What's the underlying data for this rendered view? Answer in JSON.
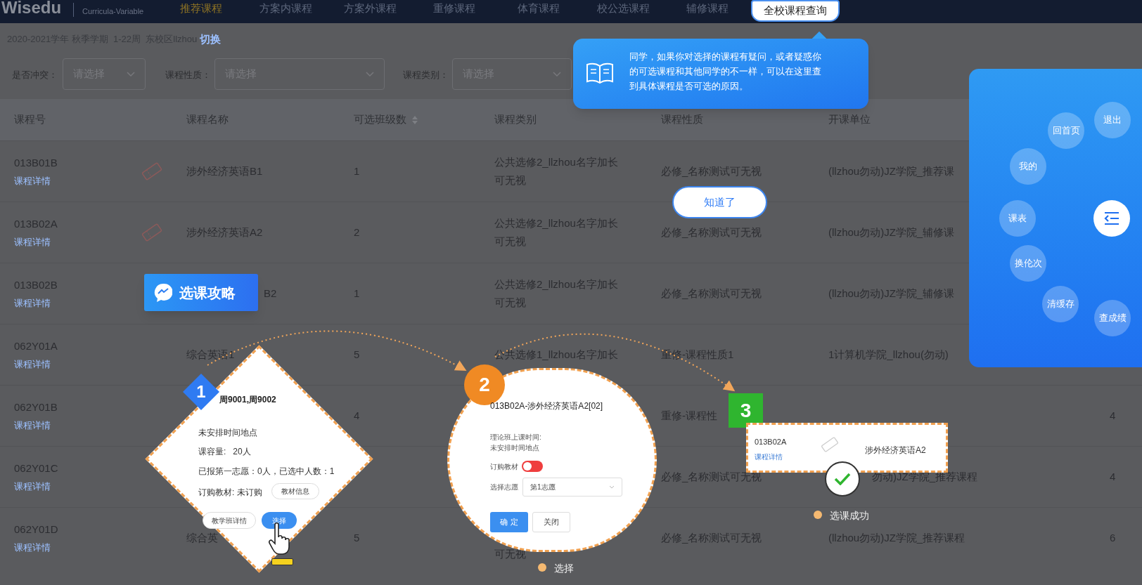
{
  "nav": {
    "logo": "Wisedu",
    "subtitle": "Curricula-Variable",
    "tabs": [
      {
        "label": "推荐课程",
        "selected": true,
        "spotlight": false
      },
      {
        "label": "方案内课程",
        "selected": false,
        "spotlight": false
      },
      {
        "label": "方案外课程",
        "selected": false,
        "spotlight": false
      },
      {
        "label": "重修课程",
        "selected": false,
        "spotlight": false
      },
      {
        "label": "体育课程",
        "selected": false,
        "spotlight": false
      },
      {
        "label": "校公选课程",
        "selected": false,
        "spotlight": false
      },
      {
        "label": "辅修课程",
        "selected": false,
        "spotlight": false
      },
      {
        "label": "全校课程查询",
        "selected": false,
        "spotlight": true
      }
    ]
  },
  "term": {
    "text": "2020-2021学年 秋季学期  1-22周  东校区llzhou",
    "switch_link": "切换"
  },
  "filters": [
    {
      "label": "是否冲突：",
      "placeholder": "请选择"
    },
    {
      "label": "课程性质：",
      "placeholder": "请选择"
    },
    {
      "label": "课程类别：",
      "placeholder": "请选择"
    }
  ],
  "table": {
    "columns": [
      {
        "label": "课程号",
        "sortable": false
      },
      {
        "label": "课程名称",
        "sortable": false
      },
      {
        "label": "可选班级数",
        "sortable": true
      },
      {
        "label": "课程类别",
        "sortable": false
      },
      {
        "label": "课程性质",
        "sortable": false
      },
      {
        "label": "开课单位",
        "sortable": false
      }
    ],
    "rows": [
      {
        "code": "013B01B",
        "detail_link": "课程详情",
        "stamp": true,
        "name": "涉外经济英语B1",
        "count": "1",
        "category": "公共选修2_llzhou名字加长可无视",
        "nature": "必修_名称测试可无视",
        "department": "(llzhou勿动)JZ学院_推荐课"
      },
      {
        "code": "013B02A",
        "detail_link": "课程详情",
        "stamp": true,
        "name": "涉外经济英语A2",
        "count": "2",
        "category": "公共选修2_llzhou名字加长可无视",
        "nature": "必修_名称测试可无视",
        "department": "(llzhou勿动)JZ学院_辅修课"
      },
      {
        "code": "013B02B",
        "detail_link": "课程详情",
        "stamp": false,
        "name_tail": "B2",
        "count": "1",
        "category": "公共选修2_llzhou名字加长可无视",
        "nature": "必修_名称测试可无视",
        "department": "(llzhou勿动)JZ学院_辅修课"
      },
      {
        "code": "062Y01A",
        "detail_link": "课程详情",
        "stamp": false,
        "name": "综合英语1",
        "count": "5",
        "category": "公共选修1_llzhou名字加长",
        "nature": "重修-课程性质1",
        "department": "1计算机学院_llzhou(勿动)"
      },
      {
        "code": "062Y01B",
        "detail_link": "课程详情",
        "stamp": false,
        "count": "4",
        "nature": "重修-课程性",
        "last": "4"
      },
      {
        "code": "062Y01C",
        "detail_link": "课程详情",
        "stamp": false,
        "nature": "必修_名称测试可无视",
        "department_tail": "勿动)JZ学院_推荐课程",
        "last": "4"
      },
      {
        "code": "062Y01D",
        "detail_link": "课程详情",
        "stamp": false,
        "name": "综合英",
        "count": "5",
        "category_tail": "可无视",
        "nature": "必修_名称测试可无视",
        "department": "(llzhou勿动)JZ学院_推荐课程",
        "last": "6"
      }
    ]
  },
  "tooltip": {
    "text": "同学，如果你对选择的课程有疑问，或者疑惑你的可选课程和其他同学的不一样，可以在这里查到具体课程是否可选的原因。",
    "button": "知道了"
  },
  "quick_menu": [
    {
      "label": "退出"
    },
    {
      "label": "回首页"
    },
    {
      "label": "我的"
    },
    {
      "label": "课表"
    },
    {
      "label": "换伦次"
    },
    {
      "label": "清缓存"
    },
    {
      "label": "查成绩"
    }
  ],
  "guide_badge": "选课攻略",
  "step1": {
    "number": "1",
    "weeks": "周9001,周9002",
    "schedule": "未安排时间地点",
    "capacity": "课容量:   20人",
    "enrollment": "已报第一志愿：0人，已选中人数：1",
    "textbook": "订购教材: 未订购",
    "textbook_button": "教材信息",
    "details_button": "教学班详情",
    "select_button": "选择"
  },
  "step2": {
    "number": "2",
    "title": "013B02A-涉外经济英语A2[02]",
    "time_label": "理论班上课时间:",
    "time_value": "未安排时间地点",
    "order_label": "订购教材",
    "order_on": false,
    "choice_label": "选择志愿",
    "choice_value": "第1志愿",
    "confirm_button": "确 定",
    "close_button": "关闭",
    "caption": "选择"
  },
  "step3": {
    "number": "3",
    "code": "013B02A",
    "detail_link": "课程详情",
    "name": "涉外经济英语A2",
    "caption": "选课成功"
  }
}
